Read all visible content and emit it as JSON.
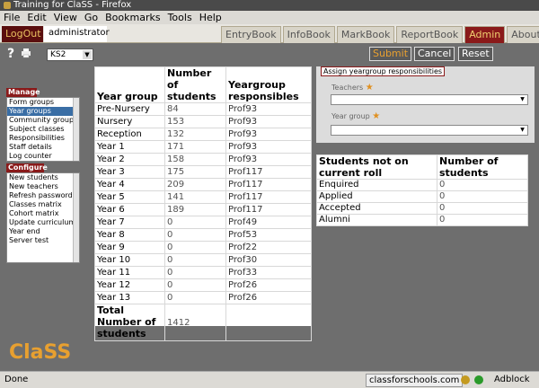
{
  "window": {
    "title": "Training for ClaSS - Firefox"
  },
  "menu": [
    "File",
    "Edit",
    "View",
    "Go",
    "Bookmarks",
    "Tools",
    "Help"
  ],
  "header": {
    "logout_label": "LogOut",
    "user": "administrator",
    "tabs": [
      {
        "label": "EntryBook",
        "active": false
      },
      {
        "label": "InfoBook",
        "active": false
      },
      {
        "label": "MarkBook",
        "active": false
      },
      {
        "label": "ReportBook",
        "active": false
      },
      {
        "label": "Admin",
        "active": true
      },
      {
        "label": "About",
        "active": false
      }
    ]
  },
  "toolbar": {
    "help_icon": "?",
    "stage_select": "KS2",
    "submit": "Submit",
    "cancel": "Cancel",
    "reset": "Reset"
  },
  "sidebar": {
    "manage_title": "Manage",
    "manage_items": [
      "Form groups",
      "Year groups",
      "Community groups",
      "Subject classes",
      "Responsibilities",
      "Staff details",
      "Log counter"
    ],
    "manage_selected": 1,
    "configure_title": "Configure",
    "configure_items": [
      "New students",
      "New teachers",
      "Refresh passwords",
      "Classes matrix",
      "Cohort matrix",
      "Update curriculum",
      "Year end",
      "Server test"
    ]
  },
  "yeargroups": {
    "headers": [
      "Year group",
      "Number of students",
      "Yeargroup responsibles"
    ],
    "rows": [
      {
        "year": "Pre-Nursery",
        "count": "84",
        "resp": "Prof93"
      },
      {
        "year": "Nursery",
        "count": "153",
        "resp": "Prof93"
      },
      {
        "year": "Reception",
        "count": "132",
        "resp": "Prof93"
      },
      {
        "year": "Year 1",
        "count": "171",
        "resp": "Prof93"
      },
      {
        "year": "Year 2",
        "count": "158",
        "resp": "Prof93"
      },
      {
        "year": "Year 3",
        "count": "175",
        "resp": "Prof117"
      },
      {
        "year": "Year 4",
        "count": "209",
        "resp": "Prof117"
      },
      {
        "year": "Year 5",
        "count": "141",
        "resp": "Prof117"
      },
      {
        "year": "Year 6",
        "count": "189",
        "resp": "Prof117"
      },
      {
        "year": "Year 7",
        "count": "0",
        "resp": "Prof49"
      },
      {
        "year": "Year 8",
        "count": "0",
        "resp": "Prof53"
      },
      {
        "year": "Year 9",
        "count": "0",
        "resp": "Prof22"
      },
      {
        "year": "Year 10",
        "count": "0",
        "resp": "Prof30"
      },
      {
        "year": "Year 11",
        "count": "0",
        "resp": "Prof33"
      },
      {
        "year": "Year 12",
        "count": "0",
        "resp": "Prof26"
      },
      {
        "year": "Year 13",
        "count": "0",
        "resp": "Prof26"
      }
    ],
    "total_label": "Total Number of students",
    "total_value": "1412"
  },
  "assign": {
    "legend": "Assign yeargroup responsibilities",
    "teachers_label": "Teachers",
    "yeargroup_label": "Year group"
  },
  "notonroll": {
    "headers": [
      "Students not on current roll",
      "Number of students"
    ],
    "rows": [
      {
        "label": "Enquired",
        "count": "0"
      },
      {
        "label": "Applied",
        "count": "0"
      },
      {
        "label": "Accepted",
        "count": "0"
      },
      {
        "label": "Alumni",
        "count": "0"
      }
    ]
  },
  "logo": "ClaSS",
  "status": {
    "text": "Done",
    "site": "classforschools.com",
    "adblock": "Adblock"
  },
  "colors": {
    "accent": "#8a1a1a",
    "logo": "#e8a030",
    "selection": "#3a6ea5"
  }
}
